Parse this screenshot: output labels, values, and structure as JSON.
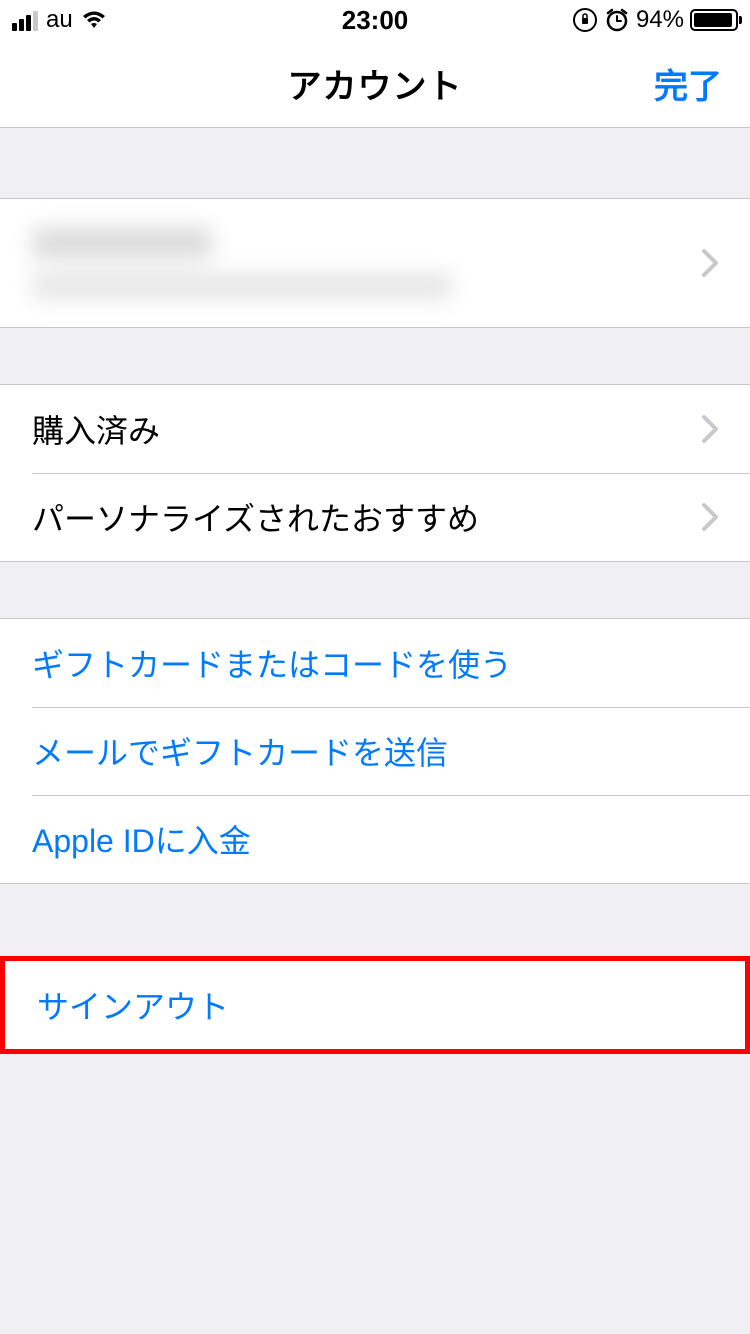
{
  "status": {
    "carrier": "au",
    "time": "23:00",
    "battery_pct": "94%"
  },
  "nav": {
    "title": "アカウント",
    "done": "完了"
  },
  "account": {
    "name_redacted": "",
    "email_redacted": ""
  },
  "rows": {
    "purchased": "購入済み",
    "personalized": "パーソナライズされたおすすめ",
    "gift_redeem": "ギフトカードまたはコードを使う",
    "gift_send": "メールでギフトカードを送信",
    "add_funds": "Apple IDに入金",
    "sign_out": "サインアウト"
  }
}
